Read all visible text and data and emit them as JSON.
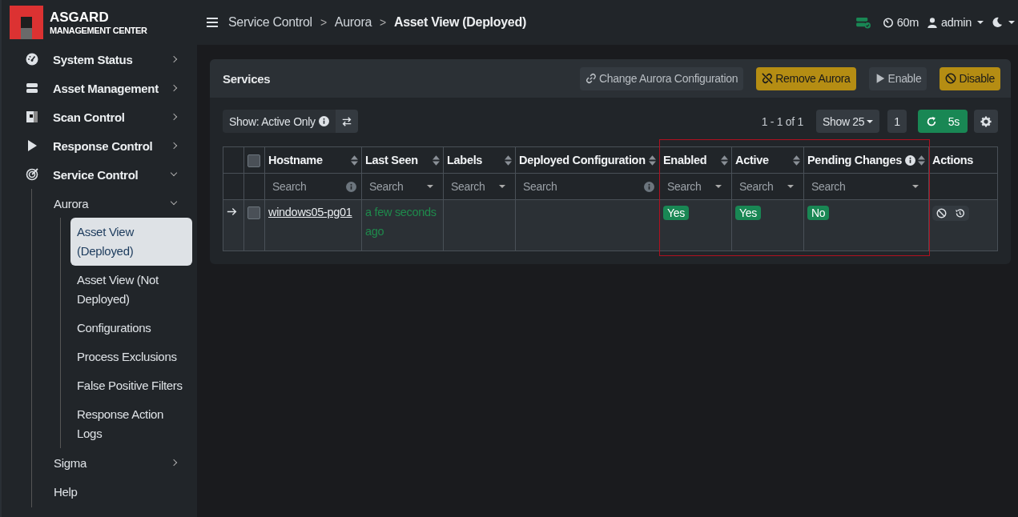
{
  "logo": {
    "title": "ASGARD",
    "subtitle": "MANAGEMENT CENTER"
  },
  "sidebar": {
    "items": [
      {
        "label": "System Status",
        "expanded": false
      },
      {
        "label": "Asset Management",
        "expanded": false
      },
      {
        "label": "Scan Control",
        "expanded": false
      },
      {
        "label": "Response Control",
        "expanded": false
      },
      {
        "label": "Service Control",
        "expanded": true,
        "children": [
          {
            "label": "Aurora",
            "expanded": true,
            "children": [
              {
                "label": "Asset View (Deployed)",
                "selected": true
              },
              {
                "label": "Asset View (Not Deployed)",
                "selected": false
              },
              {
                "label": "Configurations",
                "selected": false
              },
              {
                "label": "Process Exclusions",
                "selected": false
              },
              {
                "label": "False Positive Filters",
                "selected": false
              },
              {
                "label": "Response Action Logs",
                "selected": false
              }
            ]
          },
          {
            "label": "Sigma",
            "expanded": false
          },
          {
            "label": "Help"
          }
        ]
      }
    ]
  },
  "breadcrumbs": [
    "Service Control",
    "Aurora",
    "Asset View (Deployed)"
  ],
  "breadcrumb_separators": [
    ">",
    ">"
  ],
  "topbar": {
    "timer": "60m",
    "user": "admin"
  },
  "card": {
    "title": "Services",
    "buttons": [
      {
        "label": "Change Aurora Configuration",
        "kind": "secondary"
      },
      {
        "label": "Remove Aurora",
        "kind": "warning"
      },
      {
        "label": "Enable",
        "kind": "secondary"
      },
      {
        "label": "Disable",
        "kind": "warning"
      }
    ],
    "filter": "Show: Active Only",
    "range": "1 - 1 of 1",
    "page_size": "Show 25",
    "page": "1",
    "refresh": "5s"
  },
  "table": {
    "columns": [
      {
        "label": "Hostname",
        "sortable": true,
        "info": false,
        "filter": {
          "kind": "text",
          "placeholder": "Search"
        }
      },
      {
        "label": "Last Seen",
        "sortable": true,
        "info": false,
        "filter": {
          "kind": "select",
          "placeholder": "Search"
        }
      },
      {
        "label": "Labels",
        "sortable": true,
        "info": false,
        "filter": {
          "kind": "select",
          "placeholder": "Search"
        }
      },
      {
        "label": "Deployed Configuration",
        "sortable": true,
        "info": false,
        "filter": {
          "kind": "text",
          "placeholder": "Search"
        }
      },
      {
        "label": "Enabled",
        "sortable": true,
        "info": false,
        "filter": {
          "kind": "select",
          "placeholder": "Search"
        }
      },
      {
        "label": "Active",
        "sortable": true,
        "info": false,
        "filter": {
          "kind": "select",
          "placeholder": "Search"
        }
      },
      {
        "label": "Pending Changes",
        "sortable": true,
        "info": true,
        "filter": {
          "kind": "select",
          "placeholder": "Search"
        }
      },
      {
        "label": "Actions",
        "sortable": false,
        "info": false
      }
    ],
    "select_all_checked": false,
    "rows": [
      {
        "checked": false,
        "hostname": "windows05-pg01",
        "last_seen": "a few seconds ago",
        "enabled": "Yes",
        "active": "Yes",
        "pending": "No"
      }
    ]
  }
}
